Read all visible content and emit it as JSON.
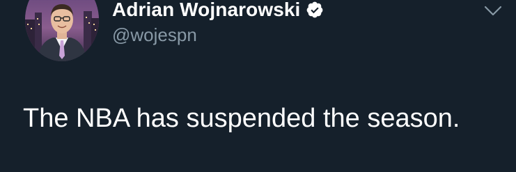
{
  "tweet": {
    "author": {
      "display_name": "Adrian Wojnarowski",
      "handle": "@wojespn",
      "verified": true,
      "verified_icon": "verified-badge-icon",
      "avatar_icon": "profile-photo"
    },
    "menu_icon": "chevron-down-icon",
    "text": "The NBA has suspended the season."
  },
  "colors": {
    "background": "#15202b",
    "text_primary": "#ffffff",
    "text_secondary": "#8899a6",
    "icon": "#8899a6"
  }
}
